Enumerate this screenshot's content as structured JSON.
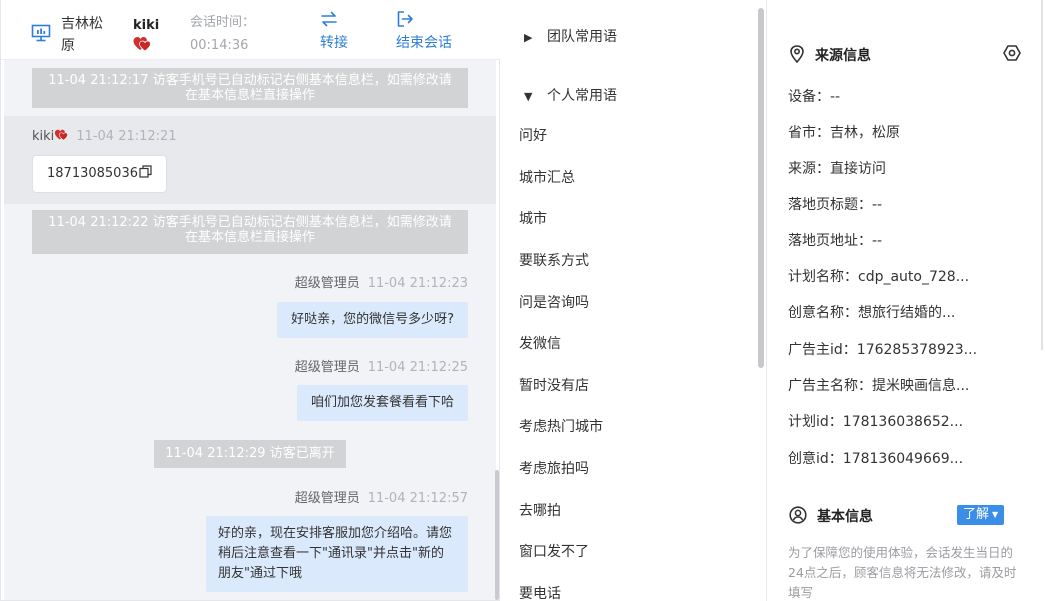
{
  "header": {
    "location": "吉林松原",
    "visitor_name": "kiki",
    "time_label": "会话时间：",
    "time_value": "00:14:36",
    "transfer_label": "转接",
    "end_label": "结束会话"
  },
  "chat": {
    "notice_1": "11-04 21:12:17 访客手机号已自动标记右侧基本信息栏，如需修改请在基本信息栏直接操作",
    "incoming": {
      "sender": "kiki",
      "time": "11-04 21:12:21",
      "text": "18713085036"
    },
    "notice_2": "11-04 21:12:22 访客手机号已自动标记右侧基本信息栏，如需修改请在基本信息栏直接操作",
    "outgoing": [
      {
        "sender": "超级管理员",
        "time": "11-04 21:12:23",
        "text": "好哒亲，您的微信号多少呀?"
      },
      {
        "sender": "超级管理员",
        "time": "11-04 21:12:25",
        "text": "咱们加您发套餐看看下哈"
      },
      {
        "sender": "超级管理员",
        "time": "11-04 21:12:57",
        "text": "好的亲，现在安排客服加您介绍哈。请您稍后注意查看一下\"通讯录\"并点击\"新的朋友\"通过下哦"
      }
    ],
    "leave_notice": "11-04 21:12:29 访客已离开"
  },
  "phrases": {
    "team_group": "团队常用语",
    "personal_group": "个人常用语",
    "items": [
      "问好",
      "城市汇总",
      "城市",
      "要联系方式",
      "问是咨询吗",
      "发微信",
      "暂时没有店",
      "考虑热门城市",
      "考虑旅拍吗",
      "去哪拍",
      "窗口发不了",
      "要电话"
    ]
  },
  "info": {
    "source_title": "来源信息",
    "rows": [
      {
        "label": "设备：",
        "value": "--"
      },
      {
        "label": "省市：",
        "value": "吉林，松原"
      },
      {
        "label": "来源：",
        "value": "直接访问"
      },
      {
        "label": "落地页标题：",
        "value": "--"
      },
      {
        "label": "落地页地址：",
        "value": "--"
      },
      {
        "label": "计划名称：",
        "value": "cdp_auto_728..."
      },
      {
        "label": "创意名称：",
        "value": "想旅行结婚的..."
      },
      {
        "label": "广告主id：",
        "value": "176285378923..."
      },
      {
        "label": "广告主名称：",
        "value": "提米映画信息..."
      },
      {
        "label": "计划id：",
        "value": "178136038652..."
      },
      {
        "label": "创意id：",
        "value": "178136049669..."
      }
    ],
    "basic_title": "基本信息",
    "learn_label": "了解",
    "basic_note": "为了保障您的使用体验，会话发生当日的24点之后，顾客信息将无法修改，请及时填写"
  },
  "colors": {
    "accent": "#2e7ed8",
    "button": "#3b8ee8",
    "notice_bg": "#d2d3d5",
    "outgoing_bubble": "#dbe9fc",
    "chat_bg": "#f2f3f6"
  },
  "icons": [
    "monitor-icon",
    "heart-icon",
    "transfer-icon",
    "logout-icon",
    "copy-icon",
    "caret-right-icon",
    "caret-down-icon",
    "location-pin-icon",
    "settings-icon",
    "user-circle-icon"
  ]
}
